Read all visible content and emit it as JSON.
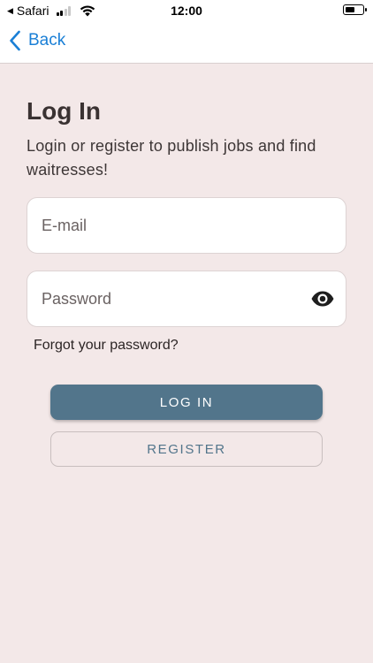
{
  "status_bar": {
    "carrier": "Safari",
    "time": "12:00"
  },
  "nav": {
    "back_label": "Back"
  },
  "login": {
    "title": "Log In",
    "subtitle": "Login or register to publish jobs and find waitresses!",
    "email_placeholder": "E-mail",
    "email_value": "",
    "password_placeholder": "Password",
    "password_value": "",
    "forgot_label": "Forgot your password?",
    "login_button": "LOG IN",
    "register_button": "REGISTER"
  },
  "colors": {
    "background": "#f3e8e8",
    "accent": "#52758b",
    "link": "#1a7fd6"
  },
  "icons": [
    "back-triangle-icon",
    "signal-icon",
    "wifi-icon",
    "battery-icon",
    "chevron-left-icon",
    "eye-icon"
  ]
}
